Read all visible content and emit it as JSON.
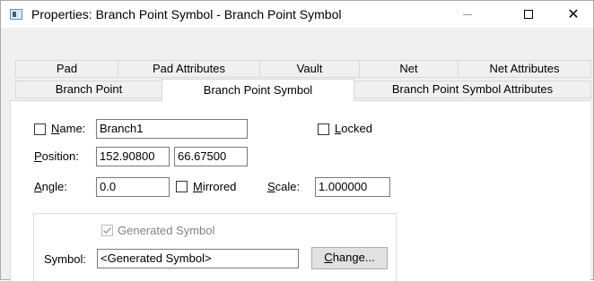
{
  "window": {
    "title": "Properties: Branch Point Symbol - Branch Point Symbol",
    "controls": {
      "minimize": "—",
      "close": "✕"
    }
  },
  "tabs_row1": [
    {
      "label": "Pad"
    },
    {
      "label": "Pad Attributes"
    },
    {
      "label": "Vault"
    },
    {
      "label": "Net"
    },
    {
      "label": "Net Attributes"
    }
  ],
  "tabs_row2": [
    {
      "label": "Branch Point"
    },
    {
      "label": "Branch Point Symbol",
      "active": true
    },
    {
      "label": "Branch Point Symbol Attributes"
    }
  ],
  "form": {
    "name": {
      "label_u": "N",
      "label_rest": "ame:",
      "value": "Branch1",
      "checked": false
    },
    "locked": {
      "label_u": "L",
      "label_rest": "ocked",
      "checked": false
    },
    "position": {
      "label_u": "P",
      "label_rest": "osition:",
      "x": "152.90800",
      "y": "66.67500"
    },
    "angle": {
      "label_u": "A",
      "label_rest": "ngle:",
      "value": "0.0"
    },
    "mirrored": {
      "label_u": "M",
      "label_rest": "irrored",
      "checked": false
    },
    "scale": {
      "label_u": "S",
      "label_rest": "cale:",
      "value": "1.000000"
    },
    "generated_symbol": {
      "label": "Generated Symbol",
      "checked": true,
      "disabled": true
    },
    "symbol": {
      "label": "Symbol:",
      "value": "<Generated Symbol>"
    },
    "change_button": {
      "label_u": "C",
      "label_rest": "hange..."
    }
  }
}
